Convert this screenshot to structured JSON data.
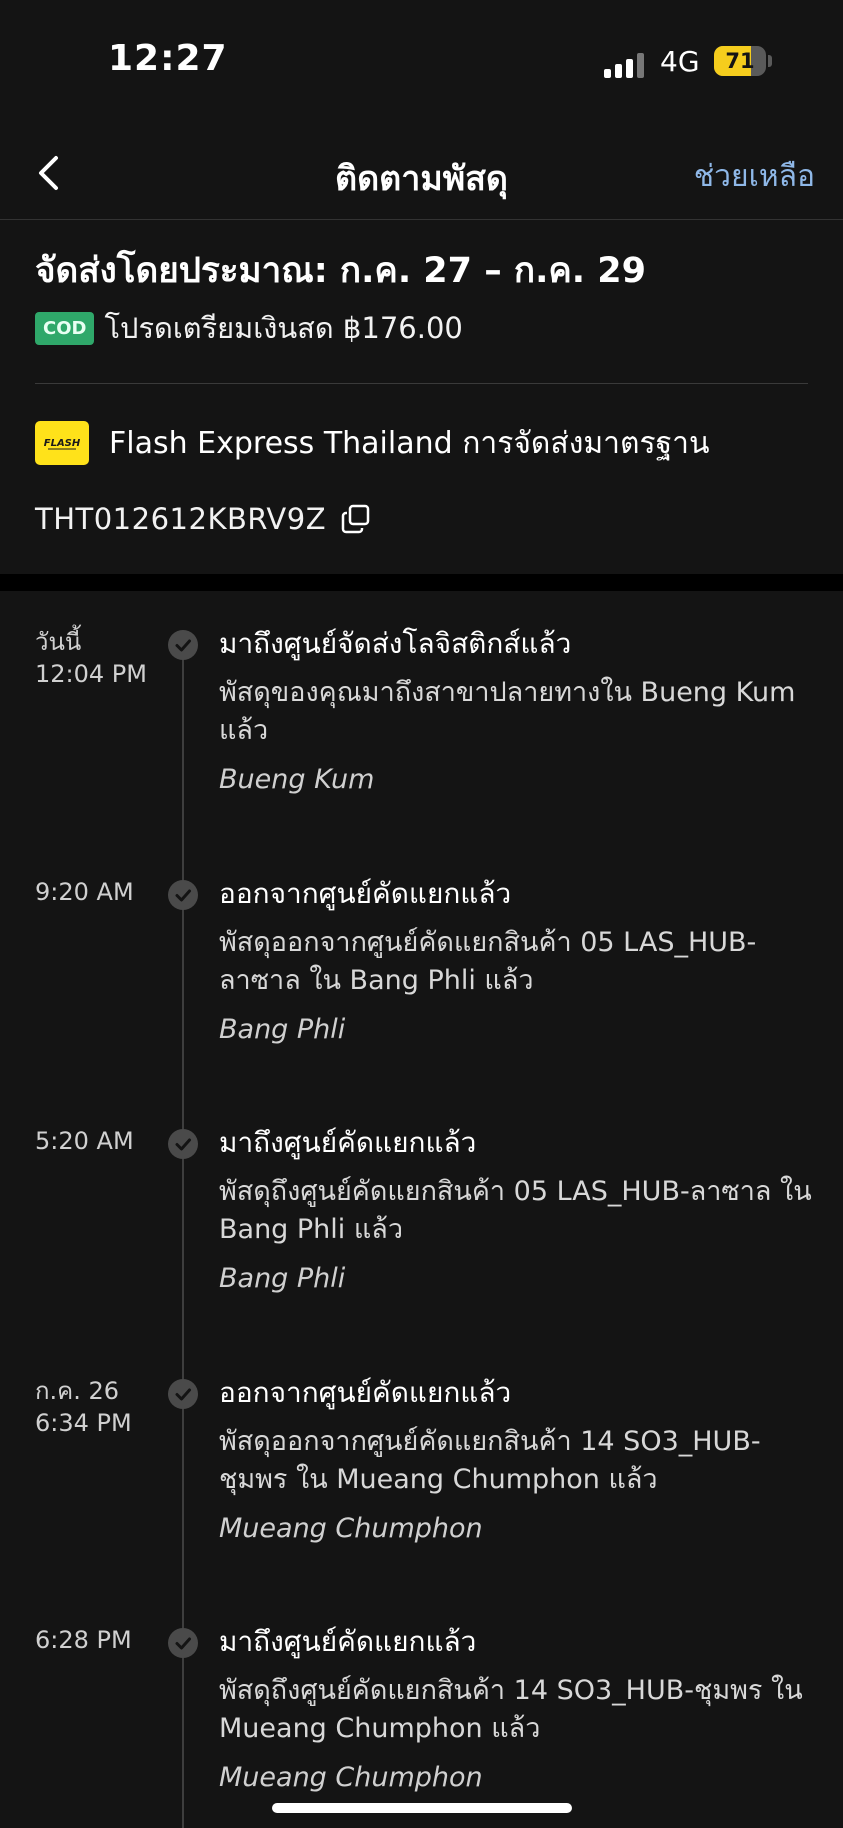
{
  "status_bar": {
    "time": "12:27",
    "network": "4G",
    "battery_percent": "71",
    "battery_level": 0.71
  },
  "header": {
    "title": "ติดตามพัสดุ",
    "help_label": "ช่วยเหลือ",
    "back_icon": "chevron-left-icon"
  },
  "summary": {
    "delivery_estimate": "จัดส่งโดยประมาณ: ก.ค. 27 – ก.ค. 29",
    "cod_badge": "COD",
    "cod_text": "โปรดเตรียมเงินสด ฿176.00",
    "carrier_name": "Flash Express Thailand การจัดส่งมาตรฐาน",
    "tracking_number": "THT012612KBRV9Z"
  },
  "colors": {
    "background": "#141414",
    "accent_link": "#8fb8e8",
    "cod_green": "#2fa86a",
    "flash_yellow": "#ffe21a",
    "battery_yellow": "#f5cd1d"
  },
  "events": [
    {
      "time": "วันนี้\n12:04 PM",
      "title": "มาถึงศูนย์จัดส่งโลจิสติกส์แล้ว",
      "desc": "พัสดุของคุณมาถึงสาขาปลายทางใน Bueng Kum แล้ว",
      "location": "Bueng Kum"
    },
    {
      "time": "9:20 AM",
      "title": "ออกจากศูนย์คัดแยกแล้ว",
      "desc": "พัสดุออกจากศูนย์คัดแยกสินค้า 05 LAS_HUB-ลาซาล ใน Bang Phli แล้ว",
      "location": "Bang Phli"
    },
    {
      "time": "5:20 AM",
      "title": "มาถึงศูนย์คัดแยกแล้ว",
      "desc": "พัสดุถึงศูนย์คัดแยกสินค้า 05 LAS_HUB-ลาซาล ใน Bang Phli แล้ว",
      "location": "Bang Phli"
    },
    {
      "time": "ก.ค. 26\n6:34 PM",
      "title": "ออกจากศูนย์คัดแยกแล้ว",
      "desc": "พัสดุออกจากศูนย์คัดแยกสินค้า 14 SO3_HUB-ชุมพร ใน Mueang Chumphon แล้ว",
      "location": "Mueang Chumphon"
    },
    {
      "time": "6:28 PM",
      "title": "มาถึงศูนย์คัดแยกแล้ว",
      "desc": "พัสดุถึงศูนย์คัดแยกสินค้า 14 SO3_HUB-ชุมพร ใน Mueang Chumphon แล้ว",
      "location": "Mueang Chumphon"
    }
  ]
}
